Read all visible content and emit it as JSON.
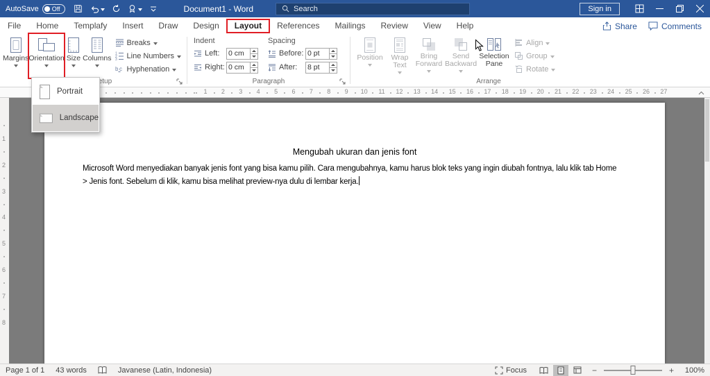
{
  "titlebar": {
    "autosave_label": "AutoSave",
    "autosave_state": "Off",
    "document_title": "Document1 - Word",
    "search_text": "Search",
    "sign_in": "Sign in"
  },
  "menu": {
    "tabs": [
      "File",
      "Home",
      "Templafy",
      "Insert",
      "Draw",
      "Design",
      "Layout",
      "References",
      "Mailings",
      "Review",
      "View",
      "Help"
    ],
    "active_tab": "Layout",
    "share": "Share",
    "comments": "Comments"
  },
  "ribbon": {
    "page_setup": {
      "label": "Page Setup",
      "margins": "Margins",
      "orientation": "Orientation",
      "size": "Size",
      "columns": "Columns",
      "breaks": "Breaks",
      "line_numbers": "Line Numbers",
      "hyphenation": "Hyphenation"
    },
    "paragraph": {
      "label": "Paragraph",
      "indent_header": "Indent",
      "spacing_header": "Spacing",
      "left_label": "Left:",
      "left_value": "0 cm",
      "right_label": "Right:",
      "right_value": "0 cm",
      "before_label": "Before:",
      "before_value": "0 pt",
      "after_label": "After:",
      "after_value": "8 pt"
    },
    "arrange": {
      "label": "Arrange",
      "position": "Position",
      "wrap_text": "Wrap Text",
      "bring_forward": "Bring Forward",
      "send_backward": "Send Backward",
      "selection_pane": "Selection Pane",
      "align": "Align",
      "group": "Group",
      "rotate": "Rotate"
    }
  },
  "orientation_menu": {
    "items": [
      {
        "label": "Portrait",
        "selected": false
      },
      {
        "label": "Landscape",
        "selected": true
      }
    ]
  },
  "ruler": {
    "h_numbers": [
      1,
      2,
      3,
      4,
      5,
      6,
      7,
      8,
      9,
      10,
      11,
      12,
      13,
      14,
      15,
      16,
      17,
      18,
      19,
      20,
      21,
      22,
      23,
      24,
      25,
      26,
      27
    ],
    "v_numbers": [
      1,
      2,
      3,
      4,
      5,
      6,
      7,
      8
    ]
  },
  "document": {
    "title": "Mengubah ukuran dan jenis font",
    "body_lines": [
      "Microsoft Word menyediakan banyak jenis font yang bisa kamu pilih. Cara mengubahnya, kamu harus blok teks yang ingin diubah fontnya, lalu klik tab Home",
      "> Jenis font. Sebelum di klik, kamu bisa melihat preview-nya dulu di lembar kerja."
    ]
  },
  "status": {
    "page": "Page 1 of 1",
    "words": "43 words",
    "language": "Javanese (Latin, Indonesia)",
    "focus": "Focus",
    "zoom_minus": "−",
    "zoom_plus": "+",
    "zoom": "100%"
  },
  "colors": {
    "titlebar_blue": "#2b579a",
    "annotation_red": "#e01e25",
    "highlight_gray": "#d2d0ce"
  }
}
